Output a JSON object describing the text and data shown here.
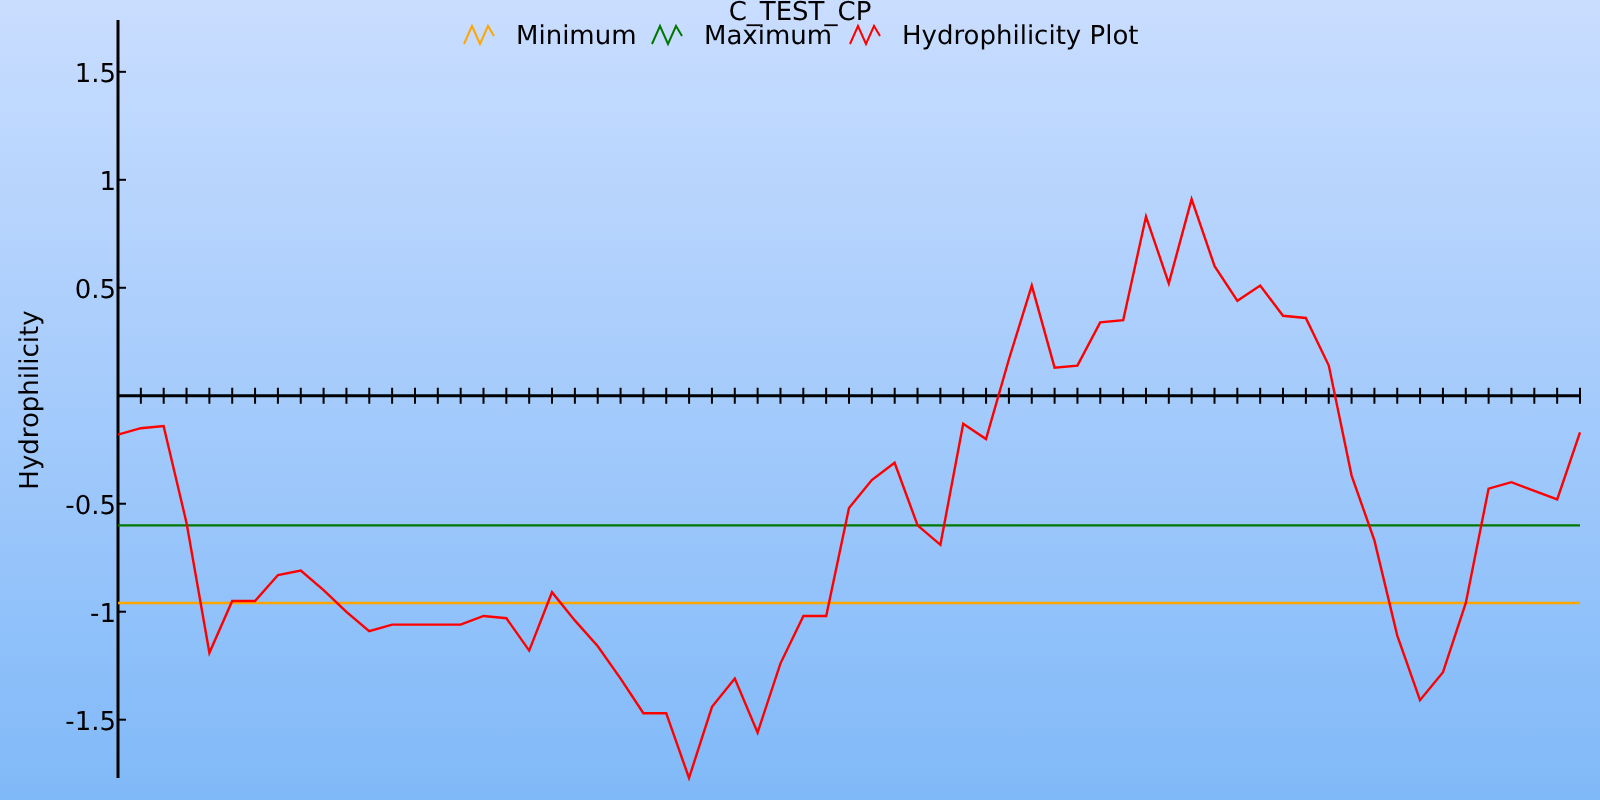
{
  "chart": {
    "chart_data": {
      "type": "line",
      "title": "C_TEST_CP",
      "ylabel": "Hydrophilicity",
      "categories": [
        null,
        null,
        null,
        null,
        null,
        null,
        null,
        null,
        null,
        null,
        null,
        null,
        null,
        null,
        null,
        null,
        null,
        null,
        null,
        null,
        null,
        null,
        null,
        null,
        null,
        null,
        null,
        null,
        null,
        null,
        null,
        null,
        null,
        null,
        null,
        null,
        null,
        null,
        null,
        null,
        null,
        null,
        null,
        null,
        null,
        null,
        null,
        null,
        null,
        null,
        null,
        null,
        null,
        null,
        null,
        null,
        null,
        null,
        null,
        null,
        null,
        null,
        null,
        null,
        null
      ],
      "ylim": [
        -1.77,
        1.74
      ],
      "legend": "top",
      "yticks": [
        -1.5,
        -1,
        -0.5,
        0.5,
        1,
        1.5
      ],
      "series": [
        {
          "name": "Minimum",
          "color": "#ffa500",
          "values": [
            -0.96,
            -0.96,
            -0.96,
            -0.96,
            -0.96,
            -0.96,
            -0.96,
            -0.96,
            -0.96,
            -0.96,
            -0.96,
            -0.96,
            -0.96,
            -0.96,
            -0.96,
            -0.96,
            -0.96,
            -0.96,
            -0.96,
            -0.96,
            -0.96,
            -0.96,
            -0.96,
            -0.96,
            -0.96,
            -0.96,
            -0.96,
            -0.96,
            -0.96,
            -0.96,
            -0.96,
            -0.96,
            -0.96,
            -0.96,
            -0.96,
            -0.96,
            -0.96,
            -0.96,
            -0.96,
            -0.96,
            -0.96,
            -0.96,
            -0.96,
            -0.96,
            -0.96,
            -0.96,
            -0.96,
            -0.96,
            -0.96,
            -0.96,
            -0.96,
            -0.96,
            -0.96,
            -0.96,
            -0.96,
            -0.96,
            -0.96,
            -0.96,
            -0.96,
            -0.96,
            -0.96,
            -0.96,
            -0.96,
            -0.96,
            -0.96
          ]
        },
        {
          "name": "Maximum",
          "color": "#007800",
          "values": [
            -0.6,
            -0.6,
            -0.6,
            -0.6,
            -0.6,
            -0.6,
            -0.6,
            -0.6,
            -0.6,
            -0.6,
            -0.6,
            -0.6,
            -0.6,
            -0.6,
            -0.6,
            -0.6,
            -0.6,
            -0.6,
            -0.6,
            -0.6,
            -0.6,
            -0.6,
            -0.6,
            -0.6,
            -0.6,
            -0.6,
            -0.6,
            -0.6,
            -0.6,
            -0.6,
            -0.6,
            -0.6,
            -0.6,
            -0.6,
            -0.6,
            -0.6,
            -0.6,
            -0.6,
            -0.6,
            -0.6,
            -0.6,
            -0.6,
            -0.6,
            -0.6,
            -0.6,
            -0.6,
            -0.6,
            -0.6,
            -0.6,
            -0.6,
            -0.6,
            -0.6,
            -0.6,
            -0.6,
            -0.6,
            -0.6,
            -0.6,
            -0.6,
            -0.6,
            -0.6,
            -0.6,
            -0.6,
            -0.6,
            -0.6,
            -0.6
          ]
        },
        {
          "name": "Hydrophilicity Plot",
          "color": "#ff0000",
          "values": [
            -0.18,
            -0.15,
            -0.14,
            -0.59,
            -1.19,
            -0.95,
            -0.95,
            -0.83,
            -0.81,
            -0.9,
            -1.0,
            -1.09,
            -1.06,
            -1.06,
            -1.06,
            -1.06,
            -1.02,
            -1.03,
            -1.18,
            -0.91,
            -1.04,
            -1.16,
            -1.31,
            -1.47,
            -1.47,
            -1.77,
            -1.44,
            -1.31,
            -1.56,
            -1.24,
            -1.02,
            -1.02,
            -0.52,
            -0.39,
            -0.31,
            -0.6,
            -0.69,
            -0.13,
            -0.2,
            0.17,
            0.51,
            0.13,
            0.14,
            0.34,
            0.35,
            0.83,
            0.52,
            0.91,
            0.6,
            0.44,
            0.51,
            0.37,
            0.36,
            0.14,
            -0.37,
            -0.67,
            -1.11,
            -1.41,
            -1.28,
            -0.96,
            -0.43,
            -0.4,
            -0.44,
            -0.48,
            -0.17
          ]
        }
      ]
    }
  }
}
